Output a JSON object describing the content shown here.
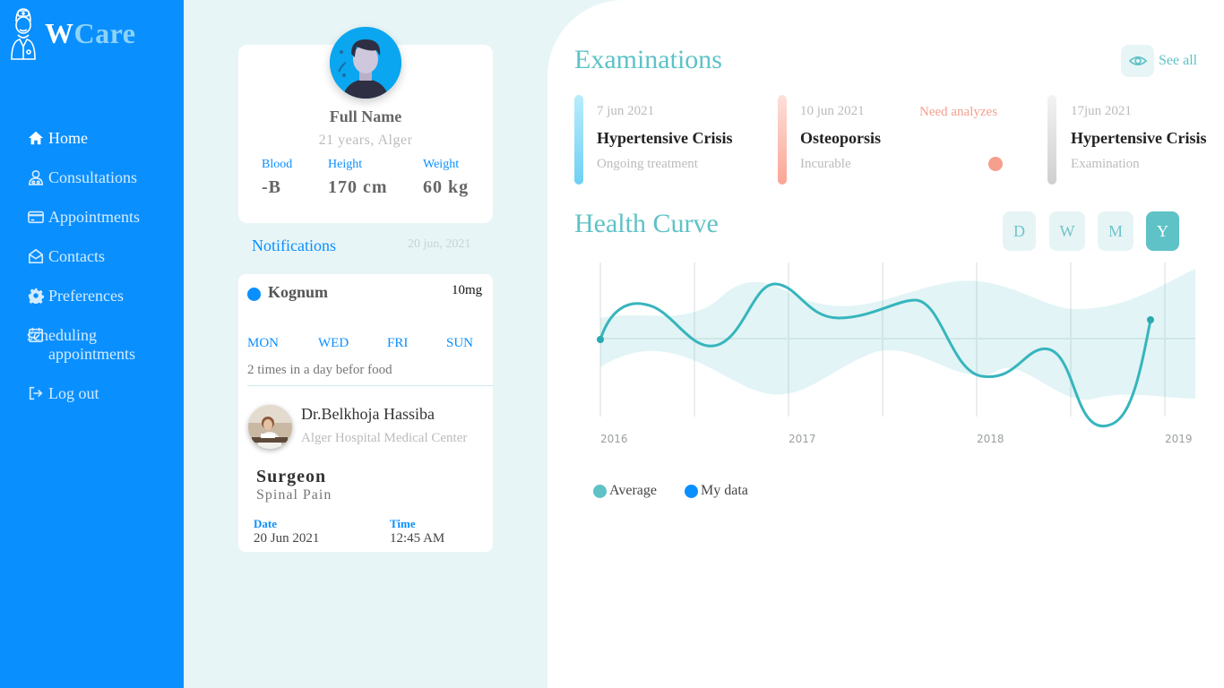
{
  "brand": {
    "first": "W",
    "rest": "Care"
  },
  "nav": [
    {
      "label": "Home",
      "icon": "home-icon"
    },
    {
      "label": "Consultations",
      "icon": "doctor-icon"
    },
    {
      "label": "Appointments",
      "icon": "card-icon"
    },
    {
      "label": "Contacts",
      "icon": "envelope-open-icon"
    },
    {
      "label": "Preferences",
      "icon": "gear-icon"
    },
    {
      "label": "scheduling appointments",
      "icon": "calendar-check-icon"
    },
    {
      "label": "Log out",
      "icon": "logout-icon"
    }
  ],
  "profile": {
    "name": "Full Name",
    "age_location": "21 years, Alger",
    "stats": [
      {
        "label": "Blood",
        "value": "-B"
      },
      {
        "label": "Height",
        "value": "170 cm"
      },
      {
        "label": "Weight",
        "value": "60 kg"
      }
    ]
  },
  "notifications": {
    "title": "Notifications",
    "date": "20 jun, 2021",
    "medication": {
      "name": "Kognum",
      "dose": "10mg",
      "days": [
        "MON",
        "WED",
        "FRI",
        "SUN"
      ],
      "note": "2 times in a day befor food"
    },
    "doctor": {
      "name": "Dr.Belkhoja Hassiba",
      "place": "Alger Hospital Medical Center",
      "specialty": "Surgeon",
      "subject": "Spinal Pain",
      "date_label": "Date",
      "date": "20 Jun 2021",
      "time_label": "Time",
      "time": "12:45 AM"
    }
  },
  "examinations": {
    "title": "Examinations",
    "see_all": "See all",
    "items": [
      {
        "date": "7 jun 2021",
        "name": "Hypertensive Crisis",
        "status": "Ongoing treatment",
        "color": "#6fd0f5"
      },
      {
        "date": "10 jun 2021",
        "name": "Osteoporsis",
        "status": "Incurable",
        "alert": "Need analyzes",
        "color": "#f9a595"
      },
      {
        "date": "17jun 2021",
        "name": "Hypertensive Crisis",
        "status": "Examination",
        "color": "#cfcfcf"
      }
    ]
  },
  "health_curve": {
    "title": "Health Curve",
    "periods": [
      "D",
      "W",
      "M",
      "Y"
    ],
    "active_period": "Y"
  },
  "chart_data": {
    "type": "line",
    "x_ticks": [
      "2016",
      "2017",
      "2018",
      "2019"
    ],
    "series": [
      {
        "name": "Average",
        "color": "#5ec2c7"
      },
      {
        "name": "My data",
        "color": "#0a8fff"
      }
    ]
  },
  "colors": {
    "sidebar": "#0a8fff",
    "accent": "#5ec2c7",
    "page_bg": "#e8f5f6",
    "alert": "#f4a08c"
  }
}
